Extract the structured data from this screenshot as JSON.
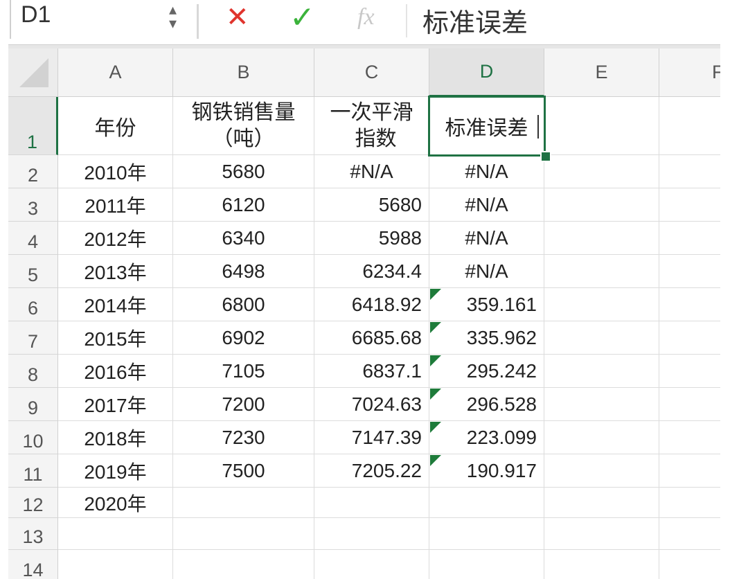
{
  "formula_bar": {
    "name_box": "D1",
    "cancel_icon": "✕",
    "enter_icon": "✓",
    "fx_label": "fx",
    "content": "标准误差"
  },
  "columns": [
    "A",
    "B",
    "C",
    "D",
    "E",
    "F"
  ],
  "rows": [
    "1",
    "2",
    "3",
    "4",
    "5",
    "6",
    "7",
    "8",
    "9",
    "10",
    "11",
    "12",
    "13",
    "14"
  ],
  "header_row": {
    "a": "年份",
    "b_line1": "钢铁销售量",
    "b_line2": "（吨）",
    "c_line1": "一次平滑",
    "c_line2": "指数",
    "d": "标准误差"
  },
  "table": [
    {
      "a": "2010年",
      "b": "5680",
      "c": "#N/A",
      "d": "#N/A"
    },
    {
      "a": "2011年",
      "b": "6120",
      "c": "5680",
      "d": "#N/A"
    },
    {
      "a": "2012年",
      "b": "6340",
      "c": "5988",
      "d": "#N/A"
    },
    {
      "a": "2013年",
      "b": "6498",
      "c": "6234.4",
      "d": "#N/A"
    },
    {
      "a": "2014年",
      "b": "6800",
      "c": "6418.92",
      "d": "359.161"
    },
    {
      "a": "2015年",
      "b": "6902",
      "c": "6685.68",
      "d": "335.962"
    },
    {
      "a": "2016年",
      "b": "7105",
      "c": "6837.1",
      "d": "295.242"
    },
    {
      "a": "2017年",
      "b": "7200",
      "c": "7024.63",
      "d": "296.528"
    },
    {
      "a": "2018年",
      "b": "7230",
      "c": "7147.39",
      "d": "223.099"
    },
    {
      "a": "2019年",
      "b": "7500",
      "c": "7205.22",
      "d": "190.917"
    },
    {
      "a": "2020年",
      "b": "",
      "c": "",
      "d": ""
    }
  ],
  "colors": {
    "accent": "#1f7244",
    "cancel": "#e0342d",
    "enter": "#3bb33b",
    "error_indicator": "#1e7b3a"
  }
}
